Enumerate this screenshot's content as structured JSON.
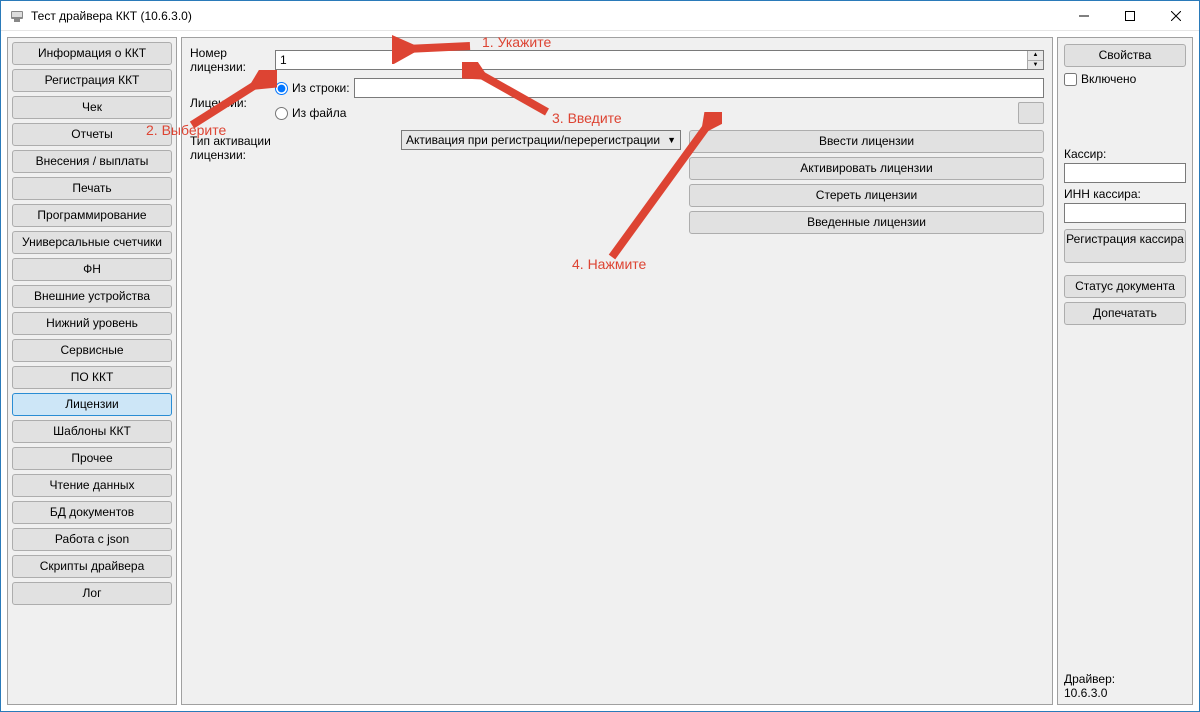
{
  "window": {
    "title": "Тест драйвера ККТ (10.6.3.0)"
  },
  "sidebar": {
    "items": [
      {
        "label": "Информация о ККТ"
      },
      {
        "label": "Регистрация ККТ"
      },
      {
        "label": "Чек"
      },
      {
        "label": "Отчеты"
      },
      {
        "label": "Внесения / выплаты"
      },
      {
        "label": "Печать"
      },
      {
        "label": "Программирование"
      },
      {
        "label": "Универсальные счетчики"
      },
      {
        "label": "ФН"
      },
      {
        "label": "Внешние устройства"
      },
      {
        "label": "Нижний уровень"
      },
      {
        "label": "Сервисные"
      },
      {
        "label": "ПО ККТ"
      },
      {
        "label": "Лицензии"
      },
      {
        "label": "Шаблоны ККТ"
      },
      {
        "label": "Прочее"
      },
      {
        "label": "Чтение данных"
      },
      {
        "label": "БД документов"
      },
      {
        "label": "Работа с json"
      },
      {
        "label": "Скрипты драйвера"
      },
      {
        "label": "Лог"
      }
    ],
    "active_index": 13
  },
  "main": {
    "license_number_label": "Номер лицензии:",
    "license_number_value": "1",
    "licenses_label": "Лицензии:",
    "radio_from_string": "Из строки:",
    "radio_from_file": "Из файла",
    "from_string_value": "",
    "from_file_path": "",
    "activation_type_label": "Тип активации лицензии:",
    "activation_type_value": "Активация при регистрации/перерегистрации",
    "buttons": {
      "enter": "Ввести лицензии",
      "activate": "Активировать лицензии",
      "erase": "Стереть лицензии",
      "entered": "Введенные лицензии"
    }
  },
  "right": {
    "properties_btn": "Свойства",
    "enabled_checkbox": "Включено",
    "cashier_label": "Кассир:",
    "cashier_value": "",
    "cashier_inn_label": "ИНН кассира:",
    "cashier_inn_value": "",
    "register_cashier_btn": "Регистрация кассира",
    "doc_status_btn": "Статус документа",
    "reprint_btn": "Допечатать",
    "driver_label": "Драйвер:",
    "driver_version": "10.6.3.0"
  },
  "annotations": {
    "a1": "1. Укажите",
    "a2": "2. Выберите",
    "a3": "3. Введите",
    "a4": "4. Нажмите"
  }
}
